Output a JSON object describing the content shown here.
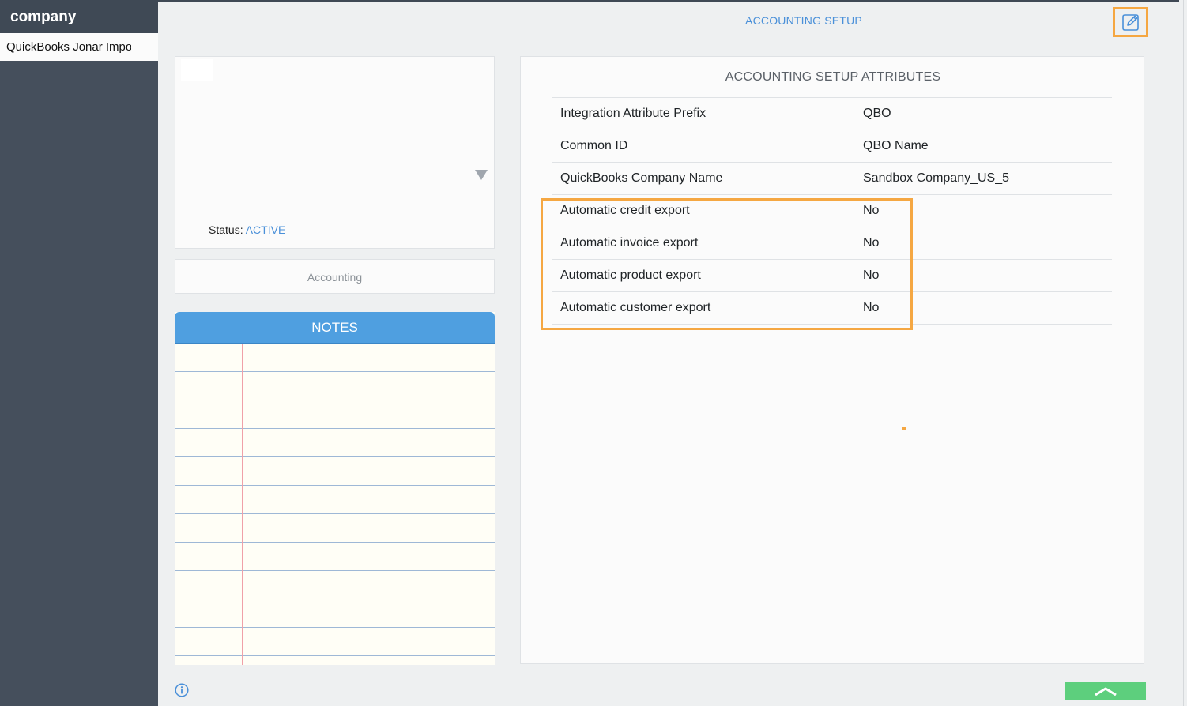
{
  "sidebar": {
    "title": "company",
    "items": [
      {
        "label": "QuickBooks Jonar Impo"
      }
    ]
  },
  "header": {
    "title": "ACCOUNTING SETUP",
    "edit_icon": "edit-pencil-icon"
  },
  "profile": {
    "status_label": "Status:",
    "status_value": "ACTIVE",
    "dropdown_icon": "caret-down-icon"
  },
  "tabs": {
    "accounting_label": "Accounting"
  },
  "notes": {
    "title": "NOTES"
  },
  "attributes": {
    "title": "ACCOUNTING SETUP ATTRIBUTES",
    "rows": [
      {
        "label": "Integration Attribute Prefix",
        "value": "QBO"
      },
      {
        "label": "Common ID",
        "value": "QBO Name"
      },
      {
        "label": "QuickBooks Company Name",
        "value": "Sandbox Company_US_5"
      },
      {
        "label": "Automatic credit export",
        "value": "No"
      },
      {
        "label": "Automatic invoice export",
        "value": "No"
      },
      {
        "label": "Automatic product export",
        "value": "No"
      },
      {
        "label": "Automatic customer export",
        "value": "No"
      }
    ]
  },
  "footer": {
    "info_icon": "info-icon",
    "scroll_top_icon": "chevron-up-icon"
  },
  "colors": {
    "accent": "#4a90d9",
    "highlight": "#f5a742",
    "sidebar": "#454f5c",
    "notes_header": "#4f9fe0",
    "scroll_button": "#5dcf7d"
  }
}
